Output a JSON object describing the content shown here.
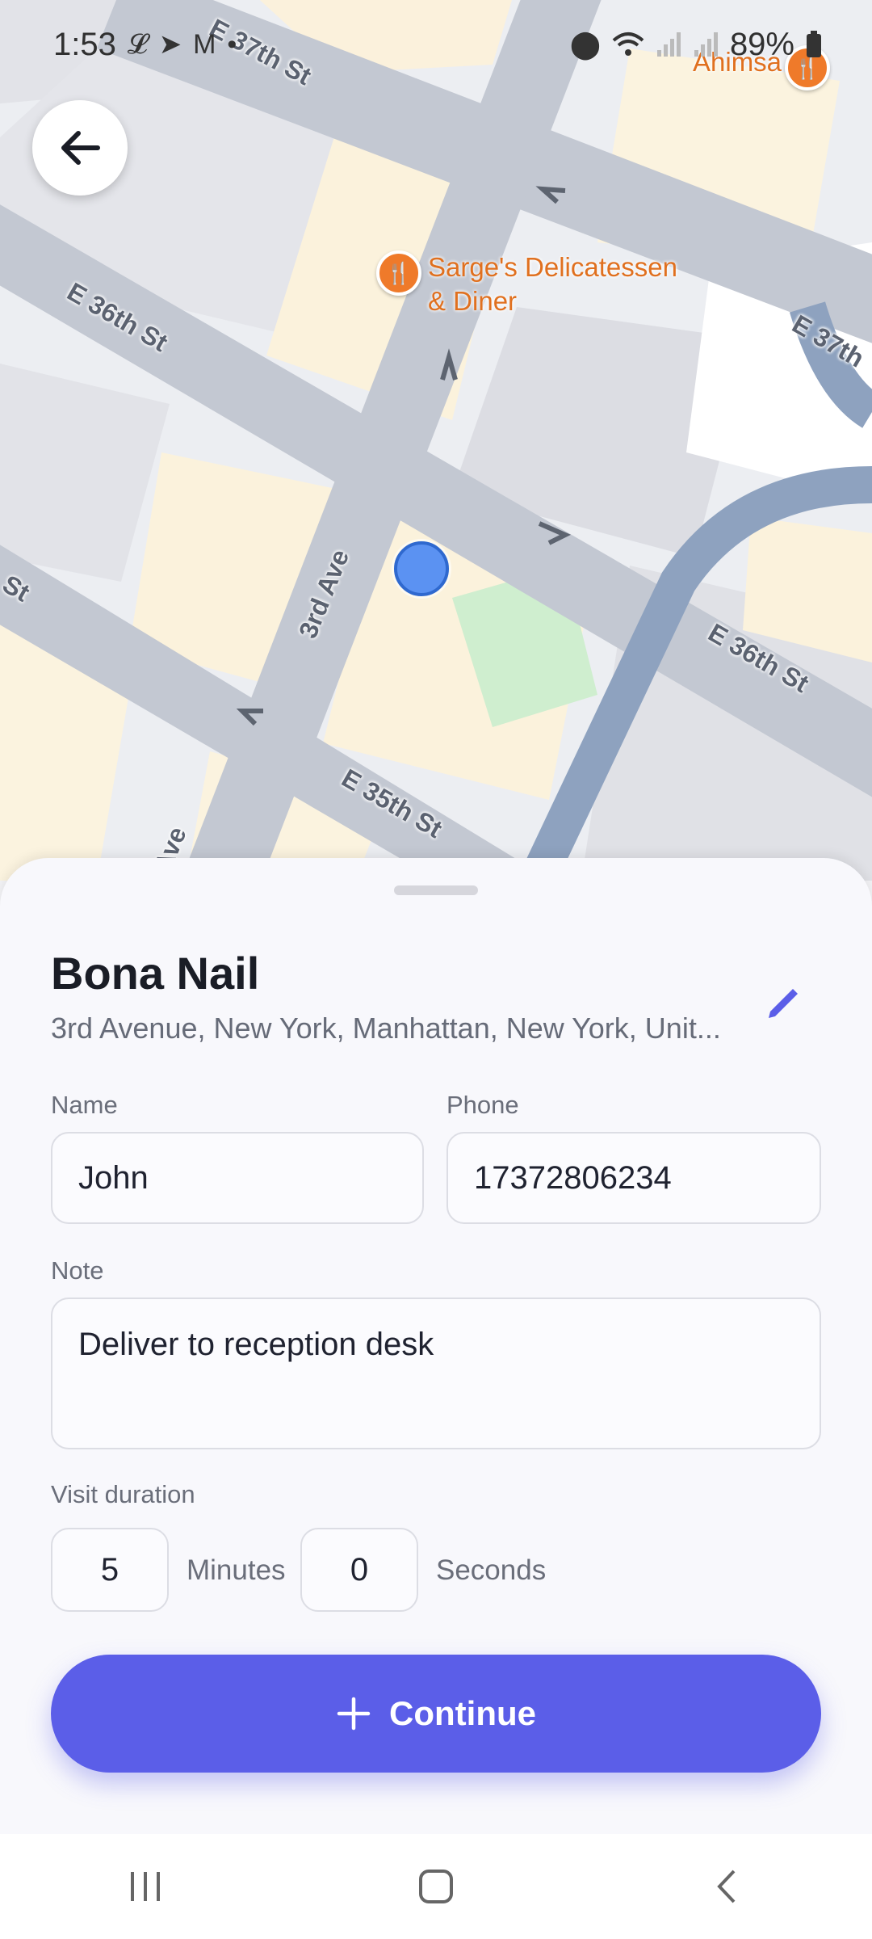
{
  "status_bar": {
    "time": "1:53",
    "battery": "89%",
    "left_icons": [
      "lyft-icon",
      "telegram-icon",
      "gmail-icon",
      "dot-icon"
    ],
    "right_icons": [
      "location-icon",
      "wifi-icon",
      "signal-icon",
      "signal-icon",
      "battery-icon"
    ]
  },
  "map": {
    "streets": {
      "e37_top": "E 37th St",
      "e36_left": "E 36th St",
      "e37_right": "E 37th",
      "third_ave": "3rd Ave",
      "e36_right": "E 36th St",
      "st_left": "St",
      "e35": "E 35th St",
      "ave_bottom": "Ave"
    },
    "pois": {
      "sarges": "Sarge's Delicatessen\n& Diner",
      "ahimsa": "Ahimsa"
    }
  },
  "sheet": {
    "title": "Bona Nail",
    "address": "3rd Avenue, New York, Manhattan, New York, Unit...",
    "name_label": "Name",
    "name_value": "John",
    "phone_label": "Phone",
    "phone_value": "17372806234",
    "note_label": "Note",
    "note_value": "Deliver to reception desk",
    "duration_label": "Visit duration",
    "minutes_value": "5",
    "minutes_unit": "Minutes",
    "seconds_value": "0",
    "seconds_unit": "Seconds",
    "continue_label": "Continue"
  },
  "colors": {
    "accent": "#5b5ee8",
    "poi": "#ef7a2a",
    "location_dot": "#5b92f2"
  }
}
